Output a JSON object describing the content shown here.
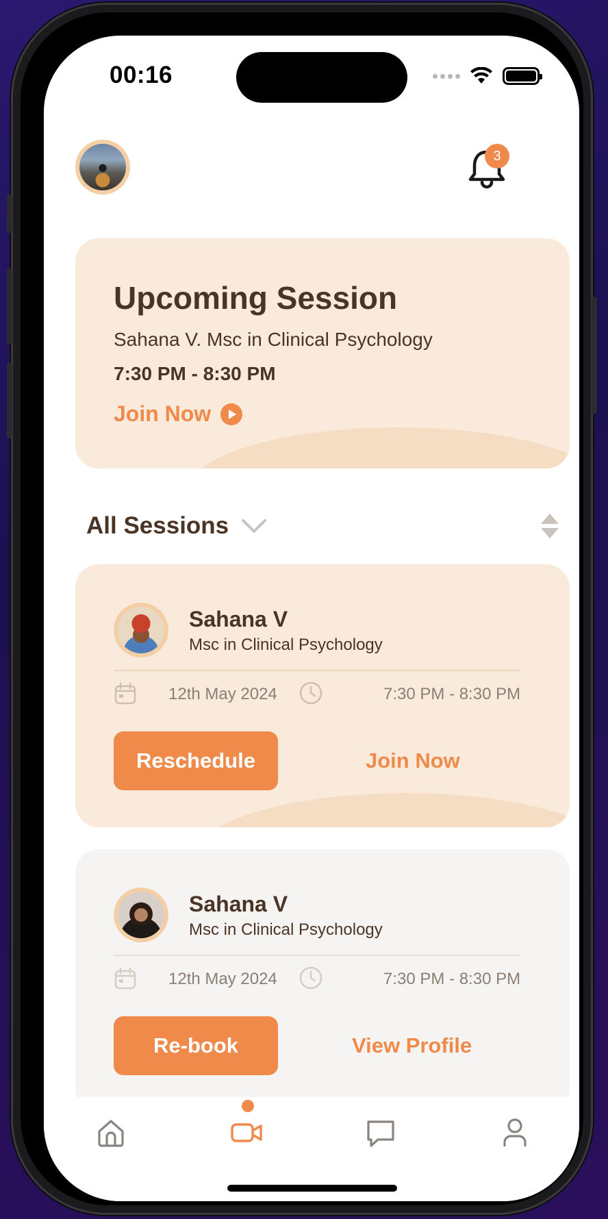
{
  "status_bar": {
    "time": "00:16"
  },
  "header": {
    "notification_count": "3",
    "notification_icon": "bell-icon"
  },
  "upcoming": {
    "title": "Upcoming Session",
    "subtitle": "Sahana V. Msc in Clinical Psychology",
    "time": "7:30 PM - 8:30 PM",
    "join_label": "Join Now"
  },
  "sessions_filter": {
    "label": "All Sessions"
  },
  "sessions": [
    {
      "name": "Sahana V",
      "qualification": "Msc in Clinical Psychology",
      "date": "12th May 2024",
      "time": "7:30 PM - 8:30 PM",
      "primary_label": "Reschedule",
      "secondary_label": "Join Now"
    },
    {
      "name": "Sahana V",
      "qualification": "Msc in Clinical Psychology",
      "date": "12th May 2024",
      "time": "7:30 PM - 8:30 PM",
      "primary_label": "Re-book",
      "secondary_label": "View Profile"
    }
  ],
  "bottom_nav": {
    "items": [
      "home-icon",
      "video-icon",
      "chat-icon",
      "profile-icon"
    ],
    "active": "video-icon"
  },
  "colors": {
    "accent": "#f08a4b",
    "card_active": "#faeadc",
    "card_past": "#f6f4f2",
    "text_primary": "#4a3426",
    "text_muted": "#8a7e75"
  }
}
